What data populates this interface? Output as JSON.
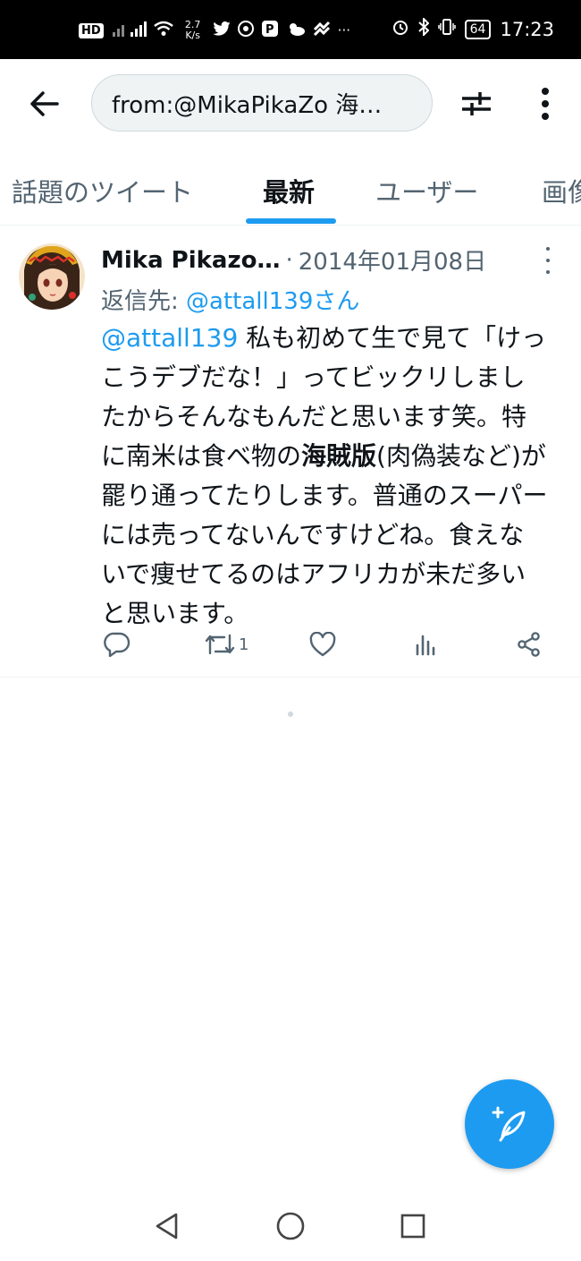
{
  "status_bar": {
    "hd": "HD",
    "hd_sub": "2",
    "speed_value": "2.7",
    "speed_unit": "K/s",
    "overflow": "···",
    "battery": "64",
    "time": "17:23"
  },
  "search": {
    "query": "from:@MikaPikaZo 海…"
  },
  "tabs": [
    {
      "label": "話題のツイート"
    },
    {
      "label": "最新"
    },
    {
      "label": "ユーザー"
    },
    {
      "label": "画像"
    }
  ],
  "tweet": {
    "author_name": "Mika Pikazo…",
    "separator": "·",
    "date": "2014年01月08日",
    "reply_prefix": "返信先: ",
    "reply_to": "@attall139さん",
    "mention": "@attall139",
    "text_part1": " 私も初めて生で見て「けっこうデブだな！」ってビックリしましたからそんなもんだと思います笑。特に南米は食べ物の",
    "text_bold": "海賊版",
    "text_part2": "(肉偽装など)が罷り通ってたりします。普通のスーパーには売ってないんですけどね。食えないで痩せてるのはアフリカが未だ多いと思います。",
    "retweet_count": "1"
  },
  "colors": {
    "accent": "#1d9bf0",
    "text_primary": "#0f1419",
    "text_secondary": "#536471"
  }
}
